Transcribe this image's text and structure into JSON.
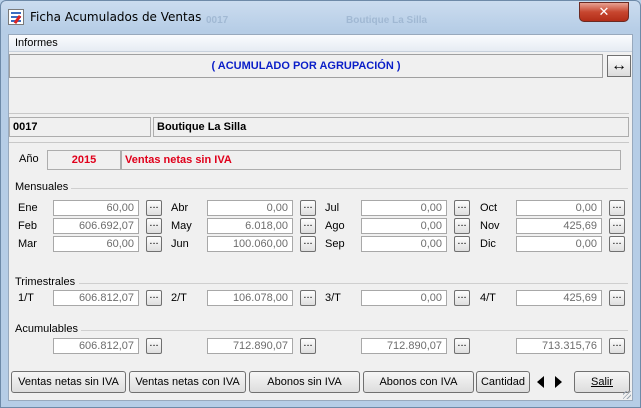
{
  "window": {
    "title": "Ficha Acumulados de Ventas",
    "ghost_code": "0017",
    "ghost_name": "Boutique La Silla",
    "close_glyph": "✕"
  },
  "menu": {
    "informes": "Informes"
  },
  "banner": {
    "title": "( ACUMULADO POR AGRUPACIÓN )",
    "expand_icon": "left-right-arrow-icon"
  },
  "group": {
    "code": "0017",
    "name": "Boutique La Silla"
  },
  "year": {
    "label": "Año",
    "value": "2015",
    "description": "Ventas netas sin IVA"
  },
  "colors": {
    "year": "#e0001b",
    "banner": "#0a1ec8"
  },
  "mensuales": {
    "title": "Mensuales",
    "months": [
      {
        "label": "Ene",
        "value": "60,00"
      },
      {
        "label": "Feb",
        "value": "606.692,07"
      },
      {
        "label": "Mar",
        "value": "60,00"
      },
      {
        "label": "Abr",
        "value": "0,00"
      },
      {
        "label": "May",
        "value": "6.018,00"
      },
      {
        "label": "Jun",
        "value": "100.060,00"
      },
      {
        "label": "Jul",
        "value": "0,00"
      },
      {
        "label": "Ago",
        "value": "0,00"
      },
      {
        "label": "Sep",
        "value": "0,00"
      },
      {
        "label": "Oct",
        "value": "0,00"
      },
      {
        "label": "Nov",
        "value": "425,69"
      },
      {
        "label": "Dic",
        "value": "0,00"
      }
    ]
  },
  "trimestrales": {
    "title": "Trimestrales",
    "quarters": [
      {
        "label": "1/T",
        "value": "606.812,07"
      },
      {
        "label": "2/T",
        "value": "106.078,00"
      },
      {
        "label": "3/T",
        "value": "0,00"
      },
      {
        "label": "4/T",
        "value": "425,69"
      }
    ]
  },
  "acumulables": {
    "title": "Acumulables",
    "values": [
      "606.812,07",
      "712.890,07",
      "712.890,07",
      "713.315,76"
    ]
  },
  "dots_label": "...",
  "buttons": {
    "ventas_sin_iva": "Ventas netas sin IVA",
    "ventas_con_iva": "Ventas netas con IVA",
    "abonos_sin_iva": "Abonos sin IVA",
    "abonos_con_iva": "Abonos con IVA",
    "cantidad": "Cantidad",
    "salir": "Salir"
  }
}
